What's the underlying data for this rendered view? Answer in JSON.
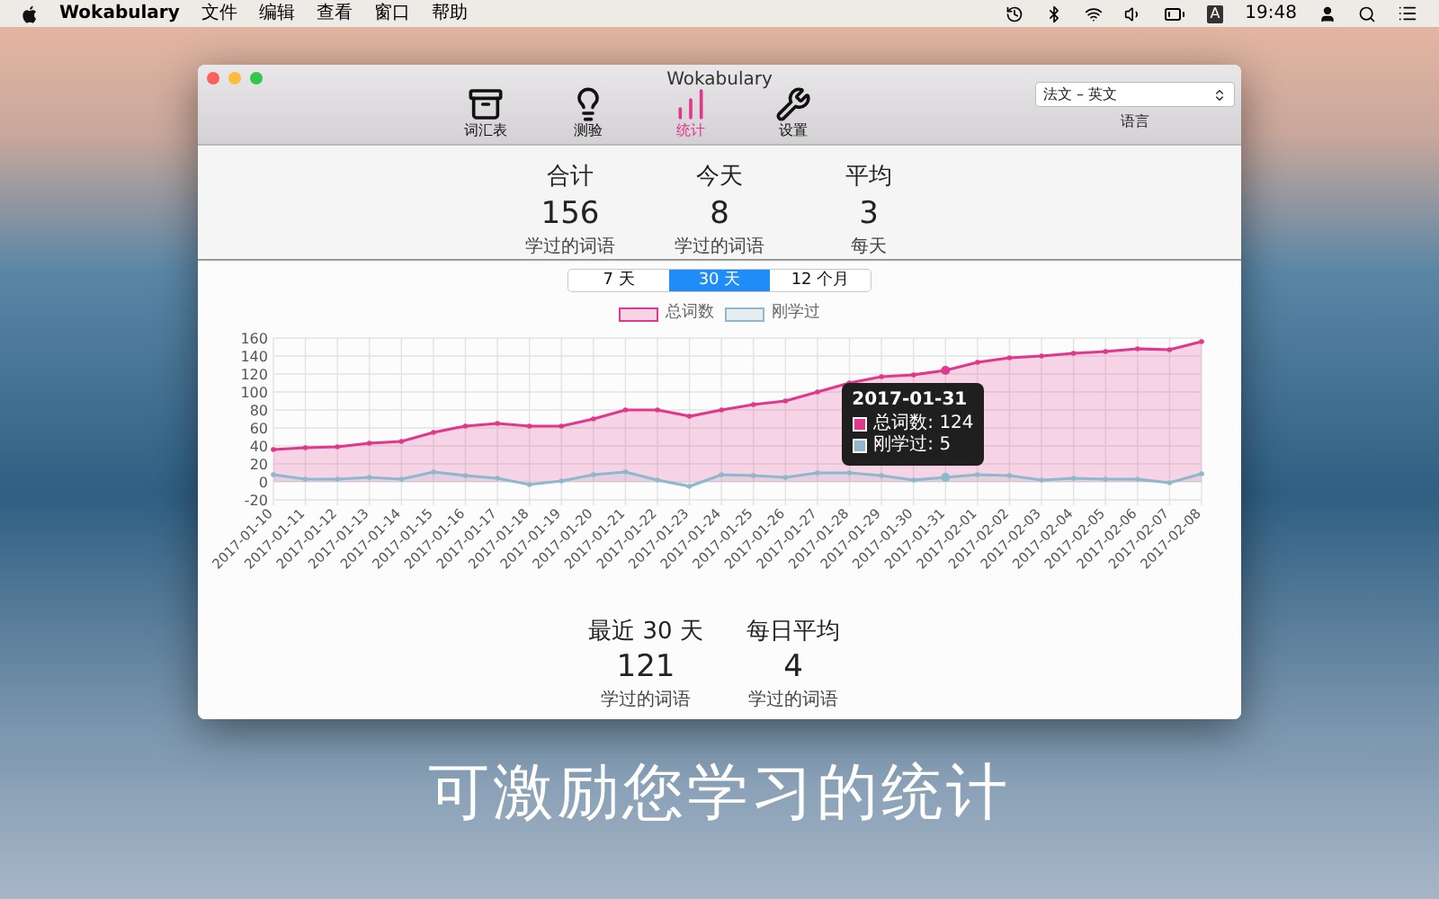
{
  "menu_bar": {
    "app_name": "Wokabulary",
    "menus": [
      "文件",
      "编辑",
      "查看",
      "窗口",
      "帮助"
    ],
    "input_source": "A",
    "time": "19:48"
  },
  "window": {
    "title": "Wokabulary"
  },
  "toolbar": {
    "items": [
      {
        "label": "词汇表",
        "kind": "archive",
        "selected": false
      },
      {
        "label": "测验",
        "kind": "bulb",
        "selected": false
      },
      {
        "label": "统计",
        "kind": "chart",
        "selected": true
      },
      {
        "label": "设置",
        "kind": "tools",
        "selected": false
      }
    ],
    "language": {
      "value": "法文 – 英文",
      "label": "语言"
    }
  },
  "summary": [
    {
      "title": "合计",
      "value": "156",
      "caption": "学过的词语"
    },
    {
      "title": "今天",
      "value": "8",
      "caption": "学过的词语"
    },
    {
      "title": "平均",
      "value": "3",
      "caption": "每天"
    }
  ],
  "ranges": [
    {
      "label": "7 天",
      "selected": false
    },
    {
      "label": "30 天",
      "selected": true
    },
    {
      "label": "12 个月",
      "selected": false
    }
  ],
  "chart": {
    "chart_data": {
      "type": "area",
      "categories": [
        "2017-01-10",
        "2017-01-11",
        "2017-01-12",
        "2017-01-13",
        "2017-01-14",
        "2017-01-15",
        "2017-01-16",
        "2017-01-17",
        "2017-01-18",
        "2017-01-19",
        "2017-01-20",
        "2017-01-21",
        "2017-01-22",
        "2017-01-23",
        "2017-01-24",
        "2017-01-25",
        "2017-01-26",
        "2017-01-27",
        "2017-01-28",
        "2017-01-29",
        "2017-01-30",
        "2017-01-31",
        "2017-02-01",
        "2017-02-02",
        "2017-02-03",
        "2017-02-04",
        "2017-02-05",
        "2017-02-06",
        "2017-02-07",
        "2017-02-08"
      ],
      "series": [
        {
          "name": "总词数",
          "color": "#e0388c",
          "values": [
            36,
            38,
            39,
            43,
            45,
            55,
            62,
            65,
            62,
            62,
            70,
            80,
            80,
            73,
            80,
            86,
            90,
            100,
            110,
            117,
            119,
            124,
            133,
            138,
            140,
            143,
            145,
            148,
            147,
            156
          ]
        },
        {
          "name": "刚学过",
          "color": "#8fb8cc",
          "values": [
            8,
            3,
            3,
            5,
            3,
            11,
            7,
            4,
            -3,
            1,
            8,
            11,
            2,
            -5,
            8,
            7,
            5,
            10,
            10,
            7,
            2,
            5,
            8,
            7,
            2,
            4,
            3,
            3,
            -1,
            9
          ]
        }
      ],
      "grid": true,
      "ylim": [
        -20,
        160
      ],
      "yticks": [
        -20,
        0,
        20,
        40,
        60,
        80,
        100,
        120,
        140,
        160
      ]
    },
    "tooltip": {
      "date": "2017-01-31",
      "lines": [
        "总词数: 124",
        "刚学过: 5"
      ]
    }
  },
  "recent": [
    {
      "title": "最近 30 天",
      "value": "121",
      "caption": "学过的词语"
    },
    {
      "title": "每日平均",
      "value": "4",
      "caption": "学过的词语"
    }
  ],
  "caption": "可激励您学习的统计"
}
